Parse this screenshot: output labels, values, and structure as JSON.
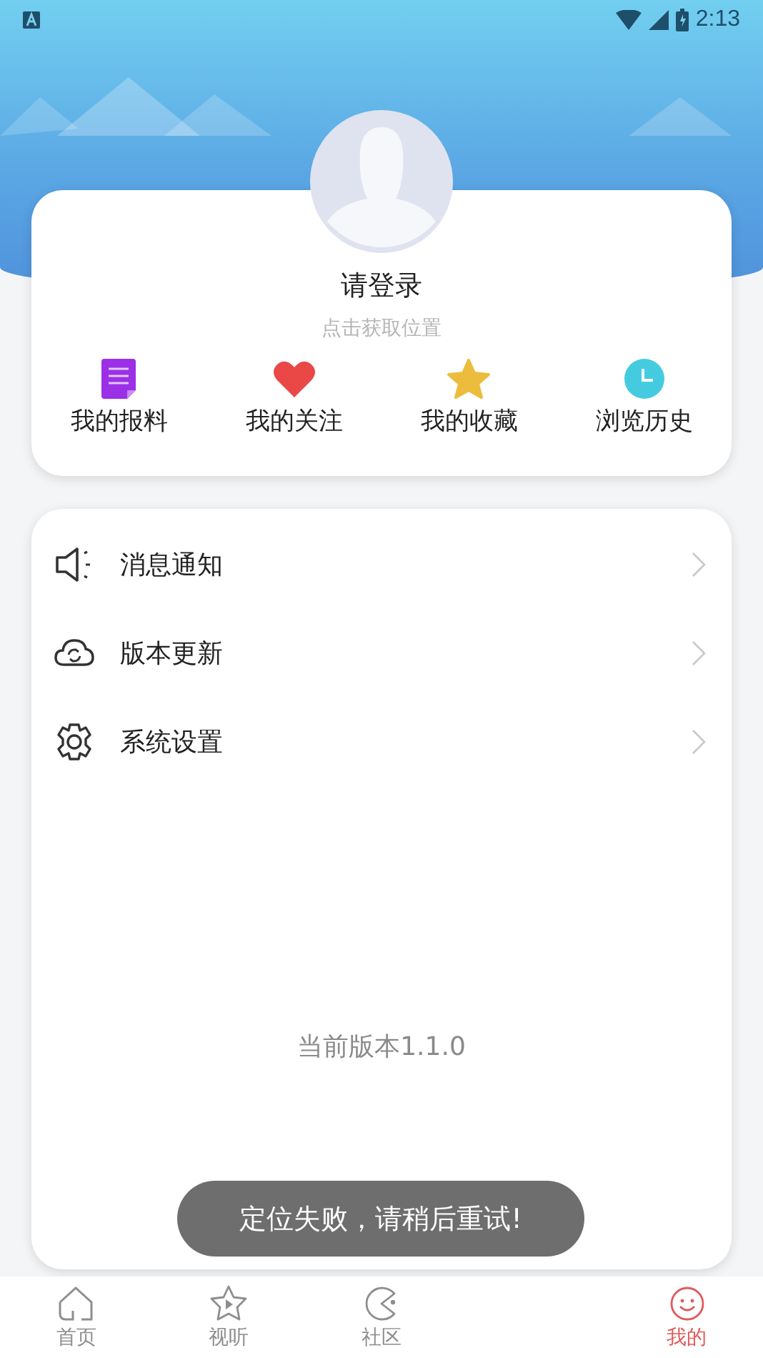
{
  "status_bar": {
    "time": "2:13"
  },
  "profile": {
    "title": "请登录",
    "subtitle": "点击获取位置"
  },
  "shortcuts": [
    {
      "kind": "report",
      "label": "我的报料"
    },
    {
      "kind": "follow",
      "label": "我的关注"
    },
    {
      "kind": "favorite",
      "label": "我的收藏"
    },
    {
      "kind": "history",
      "label": "浏览历史"
    }
  ],
  "menu": [
    {
      "kind": "notify",
      "label": "消息通知"
    },
    {
      "kind": "update",
      "label": "版本更新"
    },
    {
      "kind": "settings",
      "label": "系统设置"
    }
  ],
  "version": "当前版本1.1.0",
  "toast": "定位失败，请稍后重试!",
  "bottom_nav": [
    {
      "kind": "home",
      "label": "首页",
      "selected": false
    },
    {
      "kind": "media",
      "label": "视听",
      "selected": false
    },
    {
      "kind": "community",
      "label": "社区",
      "selected": false
    },
    {
      "kind": "mine",
      "label": "我的",
      "selected": true
    }
  ]
}
